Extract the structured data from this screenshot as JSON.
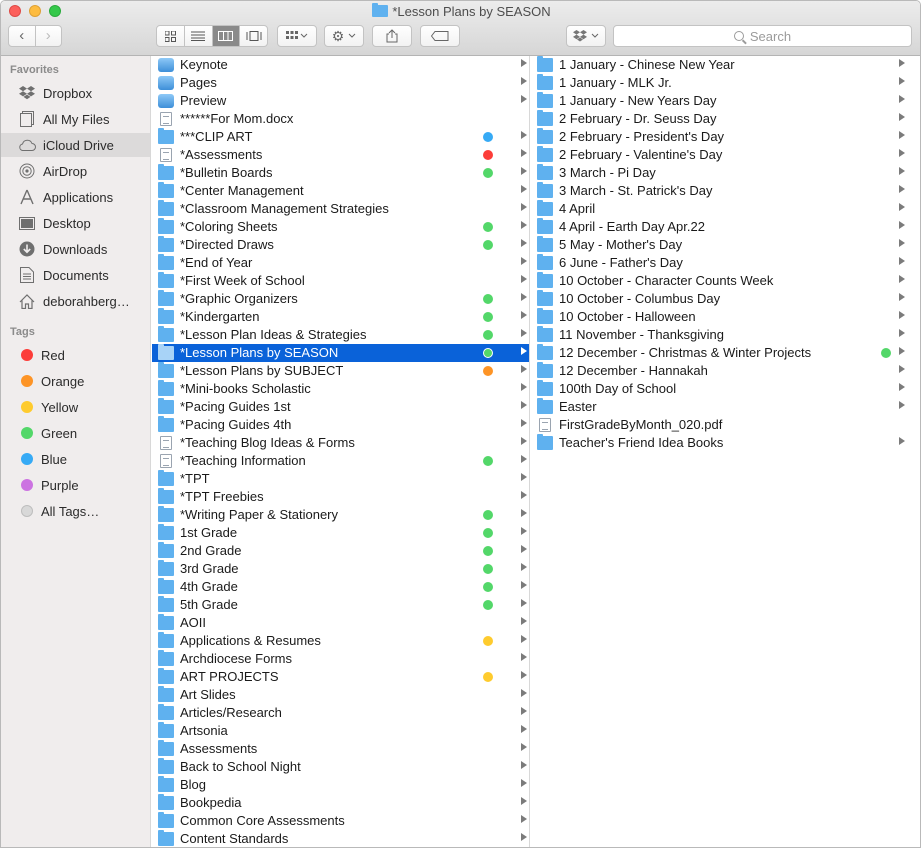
{
  "window": {
    "title": "*Lesson Plans by SEASON"
  },
  "toolbar": {
    "back_label": "‹",
    "forward_label": "›",
    "search_placeholder": "Search"
  },
  "sidebar": {
    "favorites_heading": "Favorites",
    "favorites": [
      {
        "label": "Dropbox",
        "icon": "dropbox-icon"
      },
      {
        "label": "All My Files",
        "icon": "all-files-icon"
      },
      {
        "label": "iCloud Drive",
        "icon": "cloud-icon",
        "selected": true
      },
      {
        "label": "AirDrop",
        "icon": "airdrop-icon"
      },
      {
        "label": "Applications",
        "icon": "applications-icon"
      },
      {
        "label": "Desktop",
        "icon": "desktop-icon"
      },
      {
        "label": "Downloads",
        "icon": "downloads-icon"
      },
      {
        "label": "Documents",
        "icon": "documents-icon"
      },
      {
        "label": "deborahberg…",
        "icon": "home-icon"
      }
    ],
    "tags_heading": "Tags",
    "tags": [
      {
        "label": "Red",
        "color": "#fc3d39"
      },
      {
        "label": "Orange",
        "color": "#fd9426"
      },
      {
        "label": "Yellow",
        "color": "#fecb2e"
      },
      {
        "label": "Green",
        "color": "#53d769"
      },
      {
        "label": "Blue",
        "color": "#36aaf5"
      },
      {
        "label": "Purple",
        "color": "#cc73e1"
      },
      {
        "label": "All Tags…",
        "color": "#d8d8d8"
      }
    ]
  },
  "column1": [
    {
      "name": "Keynote",
      "type": "app",
      "arrow": true
    },
    {
      "name": "Pages",
      "type": "app",
      "arrow": true
    },
    {
      "name": "Preview",
      "type": "app",
      "arrow": true
    },
    {
      "name": "******For Mom.docx",
      "type": "doc",
      "arrow": false
    },
    {
      "name": "***CLIP ART",
      "type": "folder",
      "tag": "#36aaf5",
      "arrow": true
    },
    {
      "name": "*Assessments",
      "type": "doc",
      "tag": "#fc3d39",
      "arrow": true
    },
    {
      "name": "*Bulletin Boards",
      "type": "folder",
      "tag": "#53d769",
      "arrow": true
    },
    {
      "name": "*Center Management",
      "type": "folder",
      "arrow": true
    },
    {
      "name": "*Classroom Management Strategies",
      "type": "folder",
      "arrow": true
    },
    {
      "name": "*Coloring Sheets",
      "type": "folder",
      "tag": "#53d769",
      "arrow": true
    },
    {
      "name": "*Directed Draws",
      "type": "folder",
      "tag": "#53d769",
      "arrow": true
    },
    {
      "name": "*End of Year",
      "type": "folder",
      "arrow": true
    },
    {
      "name": "*First Week of School",
      "type": "folder",
      "arrow": true
    },
    {
      "name": "*Graphic Organizers",
      "type": "folder",
      "tag": "#53d769",
      "arrow": true
    },
    {
      "name": "*Kindergarten",
      "type": "folder",
      "tag": "#53d769",
      "arrow": true
    },
    {
      "name": "*Lesson Plan Ideas & Strategies",
      "type": "folder",
      "tag": "#53d769",
      "arrow": true
    },
    {
      "name": "*Lesson Plans by SEASON",
      "type": "folder",
      "tag": "#53d769",
      "arrow": true,
      "selected": true
    },
    {
      "name": "*Lesson Plans by SUBJECT",
      "type": "folder",
      "tag": "#fd9426",
      "arrow": true
    },
    {
      "name": "*Mini-books Scholastic",
      "type": "folder",
      "arrow": true
    },
    {
      "name": "*Pacing Guides 1st",
      "type": "folder",
      "arrow": true
    },
    {
      "name": "*Pacing Guides 4th",
      "type": "folder",
      "arrow": true
    },
    {
      "name": "*Teaching Blog Ideas & Forms",
      "type": "doc",
      "arrow": true
    },
    {
      "name": "*Teaching Information",
      "type": "doc",
      "tag": "#53d769",
      "arrow": true
    },
    {
      "name": "*TPT",
      "type": "folder",
      "arrow": true
    },
    {
      "name": "*TPT Freebies",
      "type": "folder",
      "arrow": true
    },
    {
      "name": "*Writing Paper & Stationery",
      "type": "folder",
      "tag": "#53d769",
      "arrow": true
    },
    {
      "name": "1st Grade",
      "type": "folder",
      "tag": "#53d769",
      "arrow": true
    },
    {
      "name": "2nd Grade",
      "type": "folder",
      "tag": "#53d769",
      "arrow": true
    },
    {
      "name": "3rd Grade",
      "type": "folder",
      "tag": "#53d769",
      "arrow": true
    },
    {
      "name": "4th Grade",
      "type": "folder",
      "tag": "#53d769",
      "arrow": true
    },
    {
      "name": "5th Grade",
      "type": "folder",
      "tag": "#53d769",
      "arrow": true
    },
    {
      "name": "AOII",
      "type": "folder",
      "arrow": true
    },
    {
      "name": "Applications & Resumes",
      "type": "folder",
      "tag": "#fecb2e",
      "arrow": true
    },
    {
      "name": "Archdiocese Forms",
      "type": "folder",
      "arrow": true
    },
    {
      "name": "ART PROJECTS",
      "type": "folder",
      "tag": "#fecb2e",
      "arrow": true
    },
    {
      "name": "Art Slides",
      "type": "folder",
      "arrow": true
    },
    {
      "name": "Articles/Research",
      "type": "folder",
      "arrow": true
    },
    {
      "name": "Artsonia",
      "type": "folder",
      "arrow": true
    },
    {
      "name": "Assessments",
      "type": "folder",
      "arrow": true
    },
    {
      "name": "Back to School Night",
      "type": "folder",
      "arrow": true
    },
    {
      "name": "Blog",
      "type": "folder",
      "arrow": true
    },
    {
      "name": "Bookpedia",
      "type": "folder",
      "arrow": true
    },
    {
      "name": "Common Core Assessments",
      "type": "folder",
      "arrow": true
    },
    {
      "name": "Content Standards",
      "type": "folder",
      "arrow": true
    }
  ],
  "column2": [
    {
      "name": "1 January - Chinese New Year",
      "type": "folder",
      "arrow": true
    },
    {
      "name": "1 January - MLK Jr.",
      "type": "folder",
      "arrow": true
    },
    {
      "name": "1 January - New Years Day",
      "type": "folder",
      "arrow": true
    },
    {
      "name": "2 February - Dr. Seuss Day",
      "type": "folder",
      "arrow": true
    },
    {
      "name": "2 February - President's Day",
      "type": "folder",
      "arrow": true
    },
    {
      "name": "2 February - Valentine's Day",
      "type": "folder",
      "arrow": true
    },
    {
      "name": "3 March - Pi Day",
      "type": "folder",
      "arrow": true
    },
    {
      "name": "3 March - St. Patrick's Day",
      "type": "folder",
      "arrow": true
    },
    {
      "name": "4 April",
      "type": "folder",
      "arrow": true
    },
    {
      "name": "4 April - Earth Day Apr.22",
      "type": "folder",
      "arrow": true
    },
    {
      "name": "5 May - Mother's Day",
      "type": "folder",
      "arrow": true
    },
    {
      "name": "6 June - Father's Day",
      "type": "folder",
      "arrow": true
    },
    {
      "name": "10 October - Character Counts Week",
      "type": "folder",
      "arrow": true
    },
    {
      "name": "10 October - Columbus Day",
      "type": "folder",
      "arrow": true
    },
    {
      "name": "10 October - Halloween",
      "type": "folder",
      "arrow": true
    },
    {
      "name": "11 November - Thanksgiving",
      "type": "folder",
      "arrow": true
    },
    {
      "name": "12 December - Christmas & Winter Projects",
      "type": "folder",
      "tag": "#53d769",
      "arrow": true
    },
    {
      "name": "12 December - Hannakah",
      "type": "folder",
      "arrow": true
    },
    {
      "name": "100th Day of School",
      "type": "folder",
      "arrow": true
    },
    {
      "name": "Easter",
      "type": "folder",
      "arrow": true
    },
    {
      "name": "FirstGradeByMonth_020.pdf",
      "type": "doc",
      "arrow": false
    },
    {
      "name": "Teacher's Friend Idea Books",
      "type": "folder",
      "arrow": true
    }
  ]
}
